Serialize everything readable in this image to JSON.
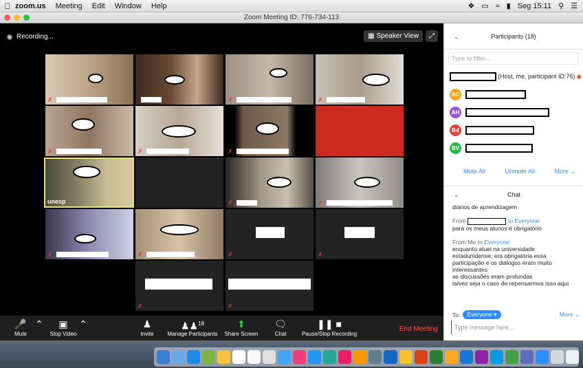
{
  "menubar": {
    "app": "zoom.us",
    "items": [
      "Meeting",
      "Edit",
      "Window",
      "Help"
    ],
    "clock": "Seg 15:11"
  },
  "window": {
    "title": "Zoom Meeting ID: 776-734-113"
  },
  "video": {
    "recording_label": "Recording...",
    "speaker_view_label": "Speaker View",
    "active_user": "unesp"
  },
  "toolbar": {
    "mute": "Mute",
    "stop_video": "Stop Video",
    "invite": "Invite",
    "manage_participants": "Manage Participants",
    "participant_count": "18",
    "share_screen": "Share Screen",
    "chat": "Chat",
    "pause_recording": "Pause/Stop Recording",
    "end_meeting": "End Meeting"
  },
  "participants": {
    "title": "Participants (18)",
    "filter_placeholder": "Type to filter...",
    "host_suffix": "(Host, me, participant ID:76)",
    "avatars": [
      {
        "initials": "AC",
        "color": "#f5a623"
      },
      {
        "initials": "AH",
        "color": "#9b59d0"
      },
      {
        "initials": "Bd",
        "color": "#d9483b"
      },
      {
        "initials": "BV",
        "color": "#2db84d"
      }
    ],
    "mute_all": "Mute All",
    "unmute_all": "Unmute All",
    "more": "More"
  },
  "chat": {
    "title": "Chat",
    "first_message": "diários de aprendizagem",
    "msg2_from": "From",
    "msg2_to": "to Everyone:",
    "msg2_text": "para os meus alunos é obrigatório",
    "msg3_from": "From Me to",
    "msg3_to": "Everyone:",
    "msg3_lines": [
      "enquanto atuei na universidade",
      "estadunidense, era obrigatória essa",
      "participação e os diálogos eram muito",
      "interessantes",
      "as discussões eram profundas",
      "talvez seja o caso de repensarmos isso aqui"
    ],
    "to_label": "To:",
    "to_value": "Everyone",
    "more": "More",
    "input_placeholder": "Type message here..."
  }
}
